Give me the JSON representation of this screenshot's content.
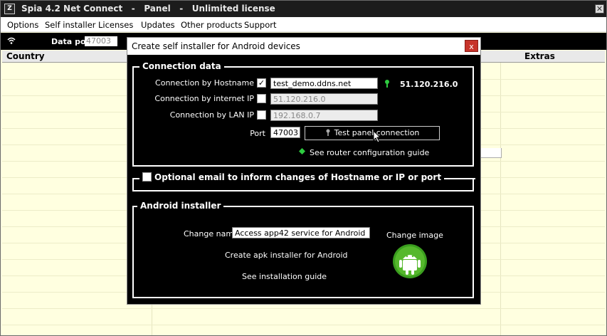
{
  "window": {
    "app_icon": "spia-app-icon",
    "title": "Spia 4.2 Net Connect   -   Panel   -   Unlimited license",
    "close_glyph": "✕"
  },
  "menu": {
    "items": [
      "Options",
      "Self installer",
      "Licenses",
      "Updates",
      "Other products",
      "Support"
    ]
  },
  "status": {
    "wifi_icon": "wifi-icon",
    "data_port_label": "Data port",
    "data_port_value": "47003"
  },
  "grid": {
    "columns": [
      "Country",
      "Extras"
    ]
  },
  "dialog": {
    "title": "Create self installer for Android devices",
    "close_glyph": "x",
    "connection": {
      "legend": "Connection data",
      "hostname_label": "Connection by Hostname",
      "hostname_checked": true,
      "hostname_value": "test_demo.ddns.net",
      "resolved_ip": "51.120.216.0",
      "internet_ip_label": "Connection by internet IP",
      "internet_ip_checked": false,
      "internet_ip_value": "51.120.216.0",
      "lan_ip_label": "Connection by LAN IP",
      "lan_ip_checked": false,
      "lan_ip_value": "192.168.0.7",
      "port_label": "Port",
      "port_value": "47003",
      "test_button": "Test panel connection",
      "router_guide": "See router configuration guide"
    },
    "email": {
      "legend": "Optional email to inform changes of Hostname or IP or port",
      "checked": false
    },
    "android": {
      "legend": "Android installer",
      "change_name_label": "Change name",
      "change_name_value": "Access app42 service for Android",
      "create_apk": "Create apk installer for Android",
      "installation_guide": "See installation guide",
      "change_image": "Change image",
      "logo_icon": "android-icon"
    },
    "accent_green": "#2ecc40",
    "close_red": "#c7342b"
  }
}
